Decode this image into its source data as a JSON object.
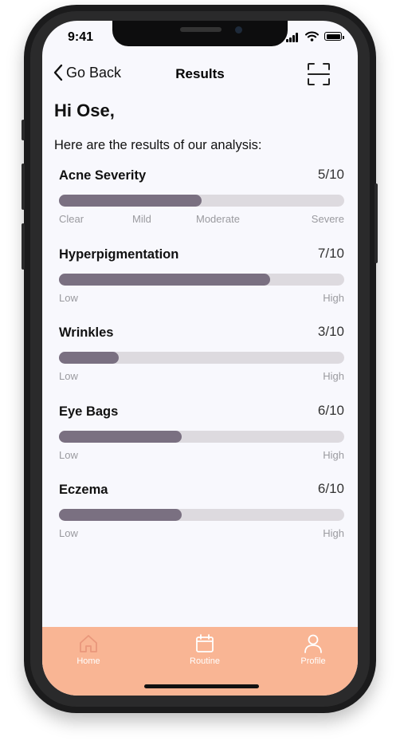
{
  "status_bar": {
    "time": "9:41"
  },
  "header": {
    "back_label": "Go Back",
    "title": "Results"
  },
  "greeting": "Hi Ose,",
  "intro": "Here are the results of our analysis:",
  "metrics": [
    {
      "name": "Acne Severity",
      "score": "5/10",
      "value": 5,
      "max": 10,
      "scale": [
        "Clear",
        "Mild",
        "Moderate",
        "Severe"
      ]
    },
    {
      "name": "Hyperpigmentation",
      "score": "7/10",
      "value": 7.4,
      "max": 10,
      "scale": [
        "Low",
        "High"
      ]
    },
    {
      "name": "Wrinkles",
      "score": "3/10",
      "value": 2.1,
      "max": 10,
      "scale": [
        "Low",
        "High"
      ]
    },
    {
      "name": "Eye Bags",
      "score": "6/10",
      "value": 4.3,
      "max": 10,
      "scale": [
        "Low",
        "High"
      ]
    },
    {
      "name": "Eczema",
      "score": "6/10",
      "value": 4.3,
      "max": 10,
      "scale": [
        "Low",
        "High"
      ]
    }
  ],
  "tabbar": {
    "items": [
      {
        "label": "Home",
        "icon": "home-icon"
      },
      {
        "label": "Routine",
        "icon": "calendar-icon"
      },
      {
        "label": "Profile",
        "icon": "user-icon"
      }
    ]
  },
  "colors": {
    "accent": "#f9b594",
    "bar_fill": "#7a7081",
    "bar_track": "#dddadf",
    "background": "#f8f8fd"
  }
}
